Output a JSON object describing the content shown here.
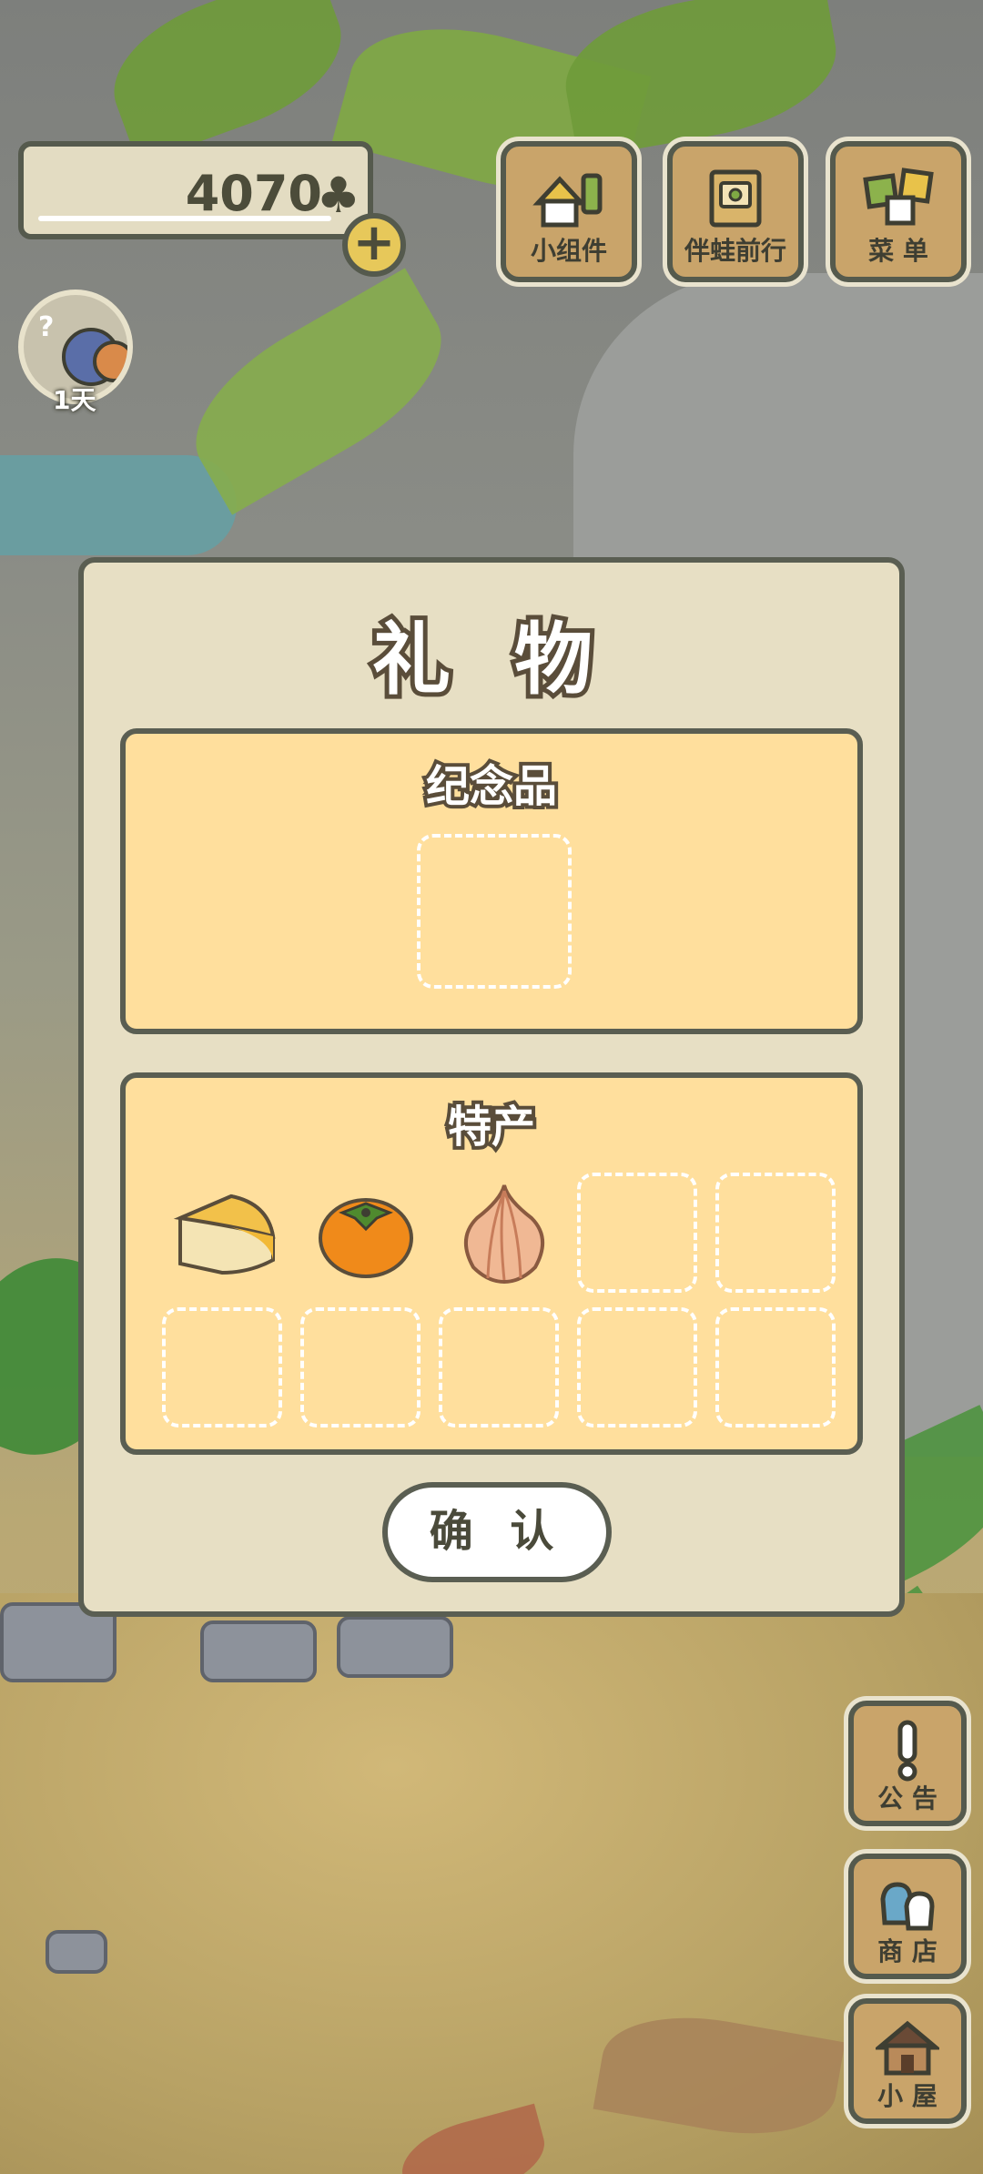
{
  "hud": {
    "currency": "4070",
    "currency_icon": "clover-icon",
    "add_currency_icon": "plus-icon",
    "days_label": "1天"
  },
  "top_menu": {
    "items": [
      {
        "label": "小组件",
        "icon": "widget-icon"
      },
      {
        "label": "伴蛙前行",
        "icon": "travel-book-icon"
      },
      {
        "label": "菜 单",
        "icon": "menu-cards-icon"
      }
    ]
  },
  "side_menu": {
    "items": [
      {
        "label": "公 告",
        "icon": "exclamation-icon"
      },
      {
        "label": "商 店",
        "icon": "shop-bags-icon"
      },
      {
        "label": "小 屋",
        "icon": "house-icon"
      }
    ]
  },
  "dialog": {
    "title": "礼 物",
    "souvenir": {
      "title": "纪念品",
      "slots": 1
    },
    "specialty": {
      "title": "特产",
      "items": [
        {
          "name": "cheese",
          "icon": "cheese-icon"
        },
        {
          "name": "persimmon",
          "icon": "persimmon-icon"
        },
        {
          "name": "onion",
          "icon": "onion-icon"
        }
      ],
      "total_slots": 10
    },
    "confirm_label": "确 认"
  },
  "colors": {
    "panel_fill": "#ffdf9d",
    "dialog_fill": "#e7dfc4",
    "outline": "#5a5e52",
    "button_wood": "#c9a46a"
  }
}
